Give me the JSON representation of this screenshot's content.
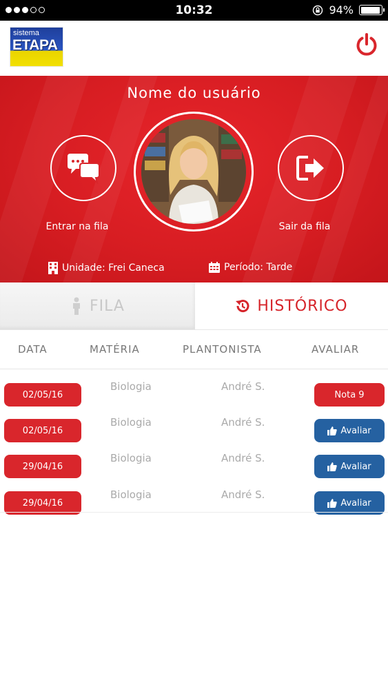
{
  "status_bar": {
    "time": "10:32",
    "battery": "94%",
    "battery_level": 0.94,
    "signal_filled": 3,
    "signal_total": 5
  },
  "header": {
    "logo_small": "sistema",
    "logo_big": "ETAPA",
    "power_icon": "power-icon"
  },
  "profile": {
    "name": "Nome do usuário",
    "enter_label": "Entrar na fila",
    "leave_label": "Sair da fila",
    "unidade": "Unidade: Frei Caneca",
    "periodo": "Período: Tarde"
  },
  "tabs": {
    "fila": "FILA",
    "historico": "HISTÓRICO",
    "active": "historico"
  },
  "table": {
    "headers": {
      "data": "DATA",
      "materia": "MATÉRIA",
      "plantonista": "PLANTONISTA",
      "avaliar": "AVALIAR"
    },
    "rows": [
      {
        "data": "02/05/16",
        "materia": "Biologia",
        "plantonista": "André S.",
        "action": "Nota 9",
        "action_type": "nota"
      },
      {
        "data": "02/05/16",
        "materia": "Biologia",
        "plantonista": "André S.",
        "action": "Avaliar",
        "action_type": "avaliar"
      },
      {
        "data": "29/04/16",
        "materia": "Biologia",
        "plantonista": "André S.",
        "action": "Avaliar",
        "action_type": "avaliar"
      },
      {
        "data": "29/04/16",
        "materia": "Biologia",
        "plantonista": "André S.",
        "action": "Avaliar",
        "action_type": "avaliar"
      }
    ]
  },
  "colors": {
    "primary_red": "#d9262c",
    "avaliar_blue": "#2561a1",
    "header_text": "#777777"
  }
}
